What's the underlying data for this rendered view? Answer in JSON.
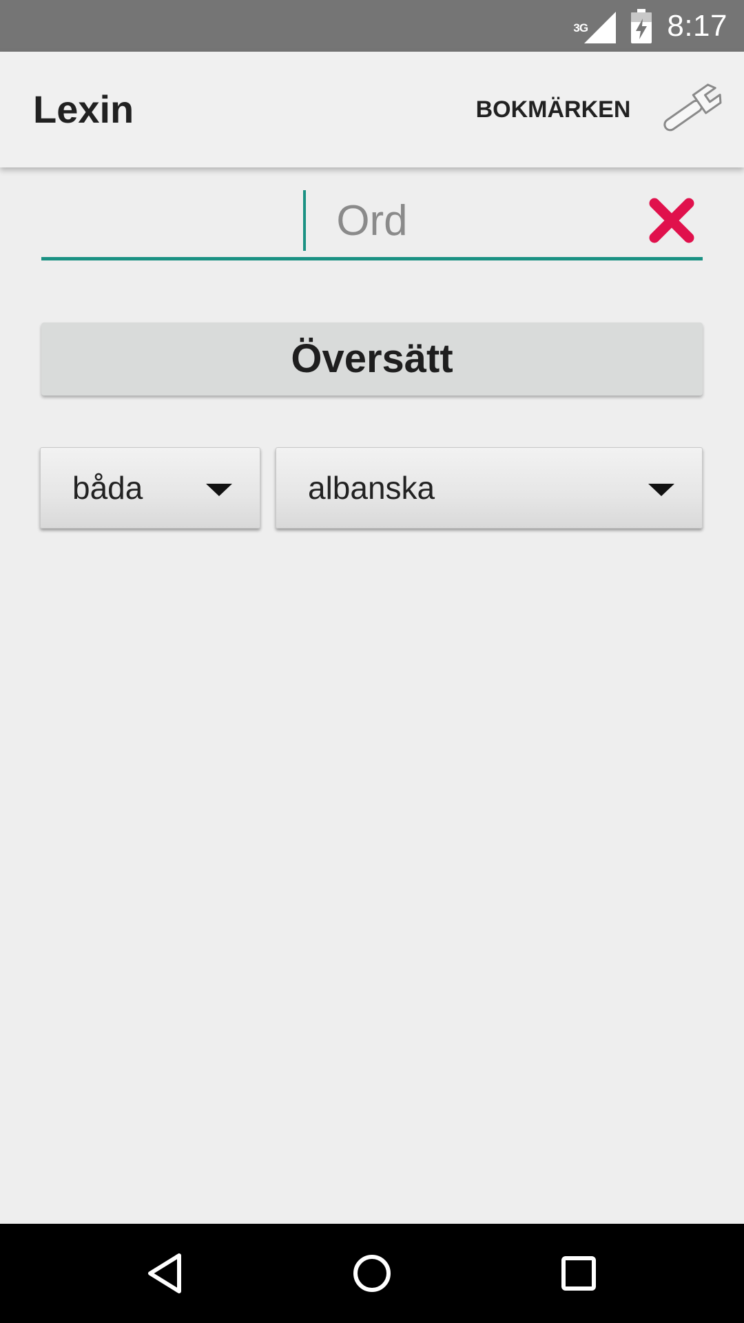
{
  "status_bar": {
    "network_type": "3G",
    "time": "8:17",
    "icons": [
      "signal-icon",
      "battery-charging-icon"
    ]
  },
  "app_bar": {
    "title": "Lexin",
    "bookmarks_label": "BOKMÄRKEN",
    "settings_icon": "wrench-icon"
  },
  "search": {
    "placeholder": "Ord",
    "value": "",
    "clear_icon": "clear-icon"
  },
  "translate_button": {
    "label": "Översätt"
  },
  "spinners": {
    "direction": {
      "selected": "båda"
    },
    "language": {
      "selected": "albanska"
    }
  },
  "nav_bar": {
    "icons": [
      "back-icon",
      "home-icon",
      "recents-icon"
    ]
  },
  "colors": {
    "accent": "#1a9183",
    "clear": "#e0114c",
    "status_bar": "#757575",
    "app_bar": "#f0f0f0",
    "background": "#eeeeee"
  }
}
